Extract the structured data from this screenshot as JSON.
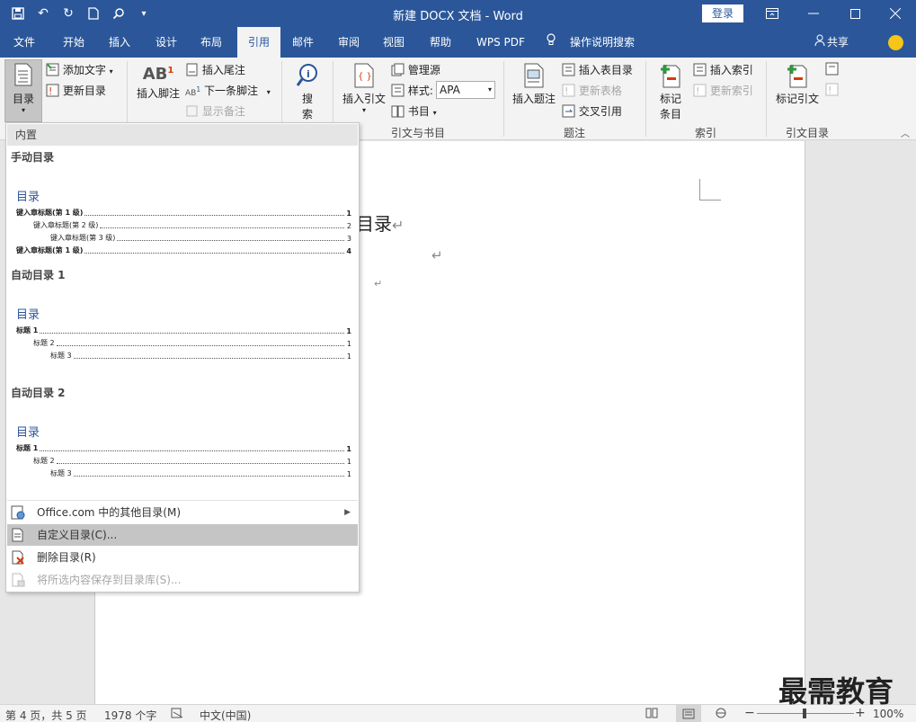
{
  "window": {
    "title": "新建 DOCX 文档  -  Word",
    "login_label": "登录"
  },
  "tabs": [
    {
      "label": "文件"
    },
    {
      "label": "开始"
    },
    {
      "label": "插入"
    },
    {
      "label": "设计"
    },
    {
      "label": "布局"
    },
    {
      "label": "引用"
    },
    {
      "label": "邮件"
    },
    {
      "label": "审阅"
    },
    {
      "label": "视图"
    },
    {
      "label": "帮助"
    },
    {
      "label": "WPS PDF"
    }
  ],
  "tell_me": "操作说明搜索",
  "share": "共享",
  "ribbon": {
    "toc": {
      "toc_label": "目录",
      "add_text": "添加文字",
      "update_toc": "更新目录"
    },
    "footnotes": {
      "insert_footnote": "插入脚注",
      "insert_endnote": "插入尾注",
      "next_footnote": "下一条脚注",
      "show_notes": "显示备注"
    },
    "research": {
      "search_line1": "搜",
      "search_line2": "索"
    },
    "citations": {
      "insert_citation": "插入引文",
      "manage_sources": "管理源",
      "style_label": "样式:",
      "style_value": "APA",
      "bibliography": "书目",
      "group_label": "引文与书目"
    },
    "captions": {
      "insert_caption": "插入题注",
      "insert_table_of_figures": "插入表目录",
      "update_table": "更新表格",
      "cross_reference": "交叉引用",
      "group_label": "题注"
    },
    "index": {
      "mark_entry_line1": "标记",
      "mark_entry_line2": "条目",
      "insert_index": "插入索引",
      "update_index": "更新索引",
      "group_label": "索引"
    },
    "toa": {
      "mark_citation": "标记引文",
      "group_label": "引文目录"
    }
  },
  "document": {
    "visible_text": "目录"
  },
  "dropdown": {
    "header": "内置",
    "manual": {
      "section_title": "手动目录",
      "heading": "目录",
      "lines": [
        {
          "label": "键入章标题(第 1 级)",
          "page": "1"
        },
        {
          "label": "键入章标题(第 2 级)",
          "page": "2"
        },
        {
          "label": "键入章标题(第 3 级)",
          "page": "3"
        },
        {
          "label": "键入章标题(第 1 级)",
          "page": "4"
        }
      ]
    },
    "auto1": {
      "section_title": "自动目录 1",
      "heading": "目录",
      "lines": [
        {
          "label": "标题 1",
          "page": "1"
        },
        {
          "label": "标题 2",
          "page": "1"
        },
        {
          "label": "标题 3",
          "page": "1"
        }
      ]
    },
    "auto2": {
      "section_title": "自动目录 2",
      "heading": "目录",
      "lines": [
        {
          "label": "标题 1",
          "page": "1"
        },
        {
          "label": "标题 2",
          "page": "1"
        },
        {
          "label": "标题 3",
          "page": "1"
        }
      ]
    },
    "menu": {
      "more_toc": "Office.com 中的其他目录(M)",
      "custom_toc": "自定义目录(C)...",
      "remove_toc": "删除目录(R)",
      "save_selection": "将所选内容保存到目录库(S)..."
    }
  },
  "statusbar": {
    "page": "第 4 页，共 5 页",
    "words": "1978 个字",
    "language": "中文(中国)",
    "zoom": "100%"
  },
  "watermark": "最需教育"
}
